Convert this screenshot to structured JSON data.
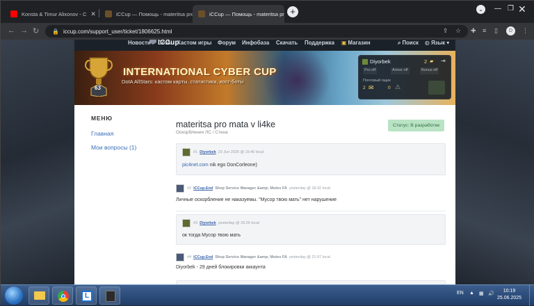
{
  "browser": {
    "tabs": [
      {
        "title": "Konsta & Timur Alixonov - С",
        "favicon_color": "#ff0000"
      },
      {
        "title": "iCCup — Помощь - materitsa pro",
        "favicon_color": "#6b4f2a"
      },
      {
        "title": "iCCup — Помощь - materitsa pro",
        "favicon_color": "#6b4f2a"
      }
    ],
    "new_tab": "+",
    "url": "iccup.com/support_user/ticket/1806625.html",
    "profile_initial": "D"
  },
  "site": {
    "logo": "ICCup",
    "nav": [
      "Новости",
      "DotA",
      "Кастом игры",
      "Форум",
      "Инфобаза",
      "Скачать",
      "Поддержка",
      "Магазин"
    ],
    "search": "Поиск",
    "language": "Язык",
    "banner": {
      "title": "INTERNATIONAL CYBER CUP",
      "subtitle": "DotA AllStars: кастом карты, статистика, хост-боты",
      "level": "63"
    },
    "user_panel": {
      "username": "Diyorbek",
      "gold": "2",
      "buttons": [
        "Pro off",
        "Armor off",
        "Bonus off"
      ],
      "mailbox_label": "Почтовый ящик",
      "mail_count": "2",
      "other_count": "0"
    }
  },
  "sidebar": {
    "heading": "МЕНЮ",
    "links": [
      "Главная",
      "Мои вопросы (1)"
    ]
  },
  "ticket": {
    "title": "materitsa pro mata v li4ke",
    "category": "Оскорбления ЛС / Стена",
    "status": "Статус: В разработке",
    "messages": [
      {
        "num": "#1",
        "user": "Diyorbek",
        "role": "",
        "time": "23 Jun 2025 @ 15:40 local",
        "text_link": "pic4net.com",
        "text": " nik ego DonCorleone)",
        "highlight": true
      },
      {
        "num": "#2",
        "user": "iCCup.End",
        "role": "Shop Service Manager &amp; Mutes FA",
        "time": "yesterday @ 18:32 local",
        "text_link": "",
        "text": "Личные оскорбление не наказуемы. \"Мусор твою мать\" нет нарушение",
        "highlight": false
      },
      {
        "num": "#3",
        "user": "Diyorbek",
        "role": "",
        "time": "yesterday @ 20:26 local",
        "text_link": "",
        "text": "ок тогда Мусор твою мать",
        "highlight": true
      },
      {
        "num": "#4",
        "user": "iCCup.End",
        "role": "Shop Service Manager &amp; Mutes FA",
        "time": "yesterday @ 21:07 local",
        "text_link": "",
        "text": "Diyorbek - 29 дней блокировки аккаунта",
        "highlight": false
      }
    ]
  },
  "taskbar": {
    "lang": "EN",
    "time": "10:19",
    "date": "25.06.2025"
  }
}
